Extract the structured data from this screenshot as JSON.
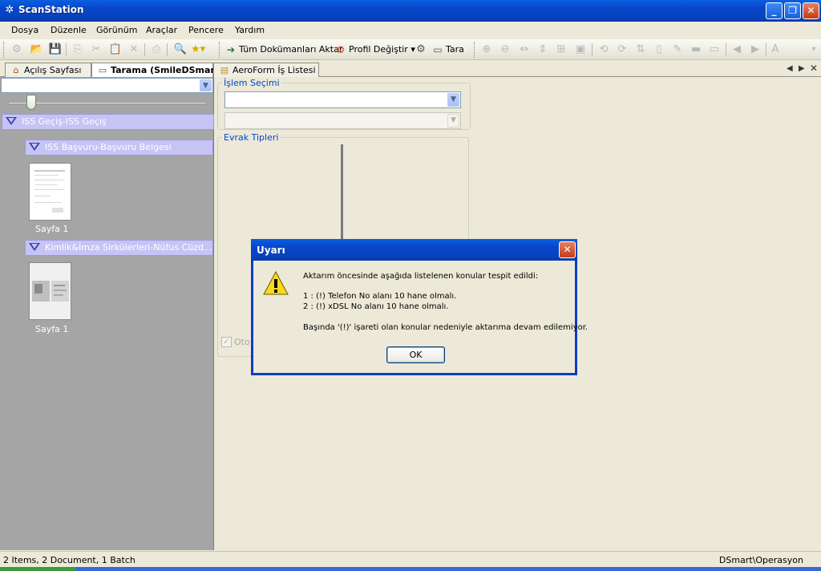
{
  "window": {
    "title": "ScanStation"
  },
  "menu": [
    "Dosya",
    "Düzenle",
    "Görünüm",
    "Araçlar",
    "Pencere",
    "Yardım"
  ],
  "toolbar": {
    "export_all": "Tüm Dokümanları Aktar",
    "change_profile": "Profil Değiştir",
    "scan": "Tara"
  },
  "tabs": [
    "Açılış Sayfası",
    "Tarama (SmileDSmart)",
    "AeroForm İş Listesi"
  ],
  "tree": {
    "group1": "ISS Geçiş-ISS Geçiş",
    "sub1": "ISS Başvuru-Başvuru Belgesi",
    "page1": "Sayfa 1",
    "sub2": "Kimlik&İmza  Sirkülerleri-Nüfus  Cüzd...",
    "page2": "Sayfa 1"
  },
  "form": {
    "process_label": "İşlem Seçimi",
    "doc_types_label": "Evrak Tipleri",
    "auto_label": "Oto"
  },
  "dialog": {
    "title": "Uyarı",
    "line1": "Aktarım öncesinde aşağıda listelenen konular tespit edildi:",
    "item1": "1 : (!) Telefon No alanı 10 hane olmalı.",
    "item2": "2 : (!) xDSL No alanı 10 hane olmalı.",
    "footer": "Başında '(!)' işareti olan konular nedeniyle aktarıma devam edilemiyor.",
    "ok": "OK"
  },
  "status": {
    "left": "2 Items, 2 Document, 1 Batch",
    "right": "DSmart\\Operasyon"
  }
}
